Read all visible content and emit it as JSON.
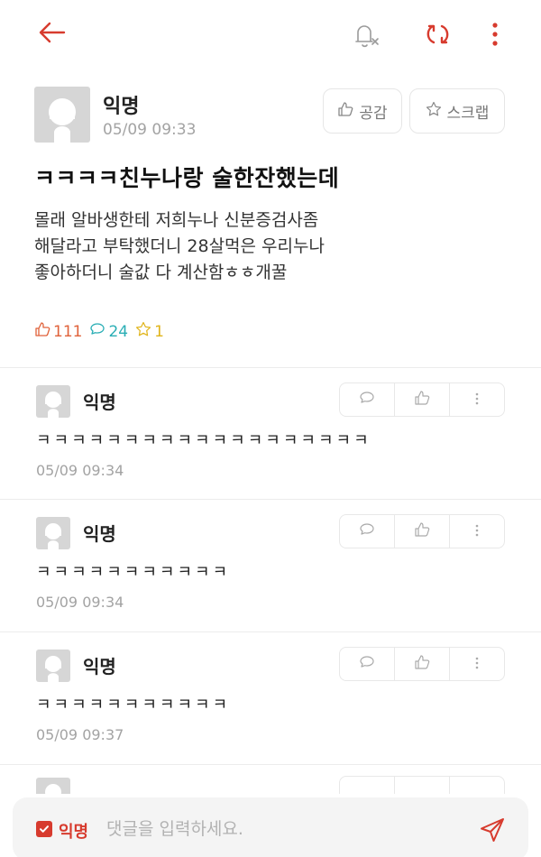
{
  "icons": {
    "back": "arrow-left-icon",
    "notification": "bell-off-icon",
    "refresh": "refresh-icon",
    "more": "more-vertical-icon",
    "like": "thumbs-up-icon",
    "scrap": "star-icon",
    "comment": "chat-bubble-icon",
    "send": "send-icon"
  },
  "colors": {
    "accent": "#d73b2e",
    "like": "#e0623a",
    "comment": "#2aaeb5",
    "scrap": "#e0b41a",
    "muted": "#a3a3a3"
  },
  "post": {
    "author": "익명",
    "time": "05/09 09:33",
    "like_button": "공감",
    "scrap_button": "스크랩",
    "title": "ㅋㅋㅋㅋ친누나랑 술한잔했는데",
    "body_lines": [
      "몰래 알바생한테 저희누나 신분증검사좀",
      "해달라고 부탁했더니 28살먹은 우리누나",
      "좋아하더니 술값 다 계산함ㅎㅎ개꿀"
    ],
    "stats": {
      "likes": "111",
      "comments": "24",
      "scraps": "1"
    }
  },
  "comments": [
    {
      "author": "익명",
      "text": "ㅋㅋㅋㅋㅋㅋㅋㅋㅋㅋㅋㅋㅋㅋㅋㅋㅋㅋㅋ",
      "time": "05/09 09:34"
    },
    {
      "author": "익명",
      "text": "ㅋㅋㅋㅋㅋㅋㅋㅋㅋㅋㅋ",
      "time": "05/09 09:34"
    },
    {
      "author": "익명",
      "text": "ㅋㅋㅋㅋㅋㅋㅋㅋㅋㅋㅋ",
      "time": "05/09 09:37"
    }
  ],
  "composer": {
    "anonymous_checked": true,
    "anonymous_label": "익명",
    "value": "",
    "placeholder": "댓글을 입력하세요."
  }
}
